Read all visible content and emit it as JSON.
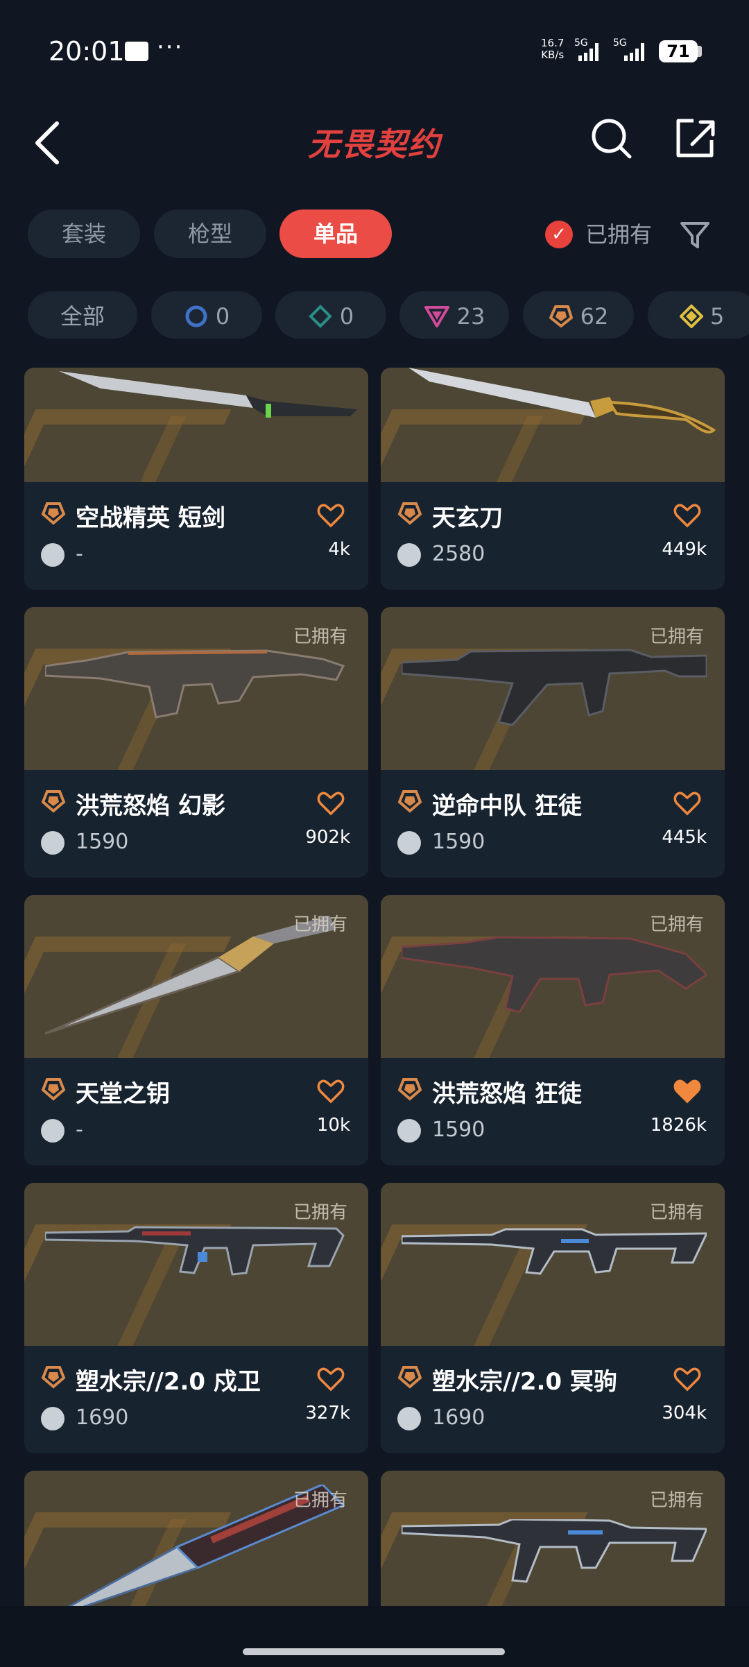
{
  "status_bar": {
    "time": "20:01",
    "net_speed": "16.7",
    "net_unit": "KB/s",
    "signal1": "5G",
    "signal2": "5G",
    "battery": "71"
  },
  "header": {
    "title": "无畏契约"
  },
  "tabs": [
    {
      "label": "套装"
    },
    {
      "label": "枪型"
    },
    {
      "label": "单品"
    }
  ],
  "owned_filter": {
    "label": "已拥有"
  },
  "chips": [
    {
      "label": "全部"
    },
    {
      "count": "0"
    },
    {
      "count": "0"
    },
    {
      "count": "23"
    },
    {
      "count": "62"
    },
    {
      "count": "5"
    }
  ],
  "items": [
    {
      "name": "空战精英 短剑",
      "price": "-",
      "likes": "4k",
      "owned": "",
      "favorited": false
    },
    {
      "name": "天玄刀",
      "price": "2580",
      "likes": "449k",
      "owned": "",
      "favorited": false
    },
    {
      "name": "洪荒怒焰 幻影",
      "price": "1590",
      "likes": "902k",
      "owned": "已拥有",
      "favorited": false
    },
    {
      "name": "逆命中队 狂徒",
      "price": "1590",
      "likes": "445k",
      "owned": "已拥有",
      "favorited": false
    },
    {
      "name": "天堂之钥",
      "price": "-",
      "likes": "10k",
      "owned": "已拥有",
      "favorited": false
    },
    {
      "name": "洪荒怒焰 狂徒",
      "price": "1590",
      "likes": "1826k",
      "owned": "已拥有",
      "favorited": true
    },
    {
      "name": "塑水宗//2.0 戍卫",
      "price": "1690",
      "likes": "327k",
      "owned": "已拥有",
      "favorited": false
    },
    {
      "name": "塑水宗//2.0 冥驹",
      "price": "1690",
      "likes": "304k",
      "owned": "已拥有",
      "favorited": false
    },
    {
      "name": "",
      "price": "",
      "likes": "",
      "owned": "已拥有",
      "favorited": false
    },
    {
      "name": "",
      "price": "",
      "likes": "",
      "owned": "已拥有",
      "favorited": false
    }
  ],
  "colors": {
    "accent": "#ec4c46",
    "tier_orange": "#d98a4a",
    "background": "#101722",
    "card": "#182330"
  }
}
